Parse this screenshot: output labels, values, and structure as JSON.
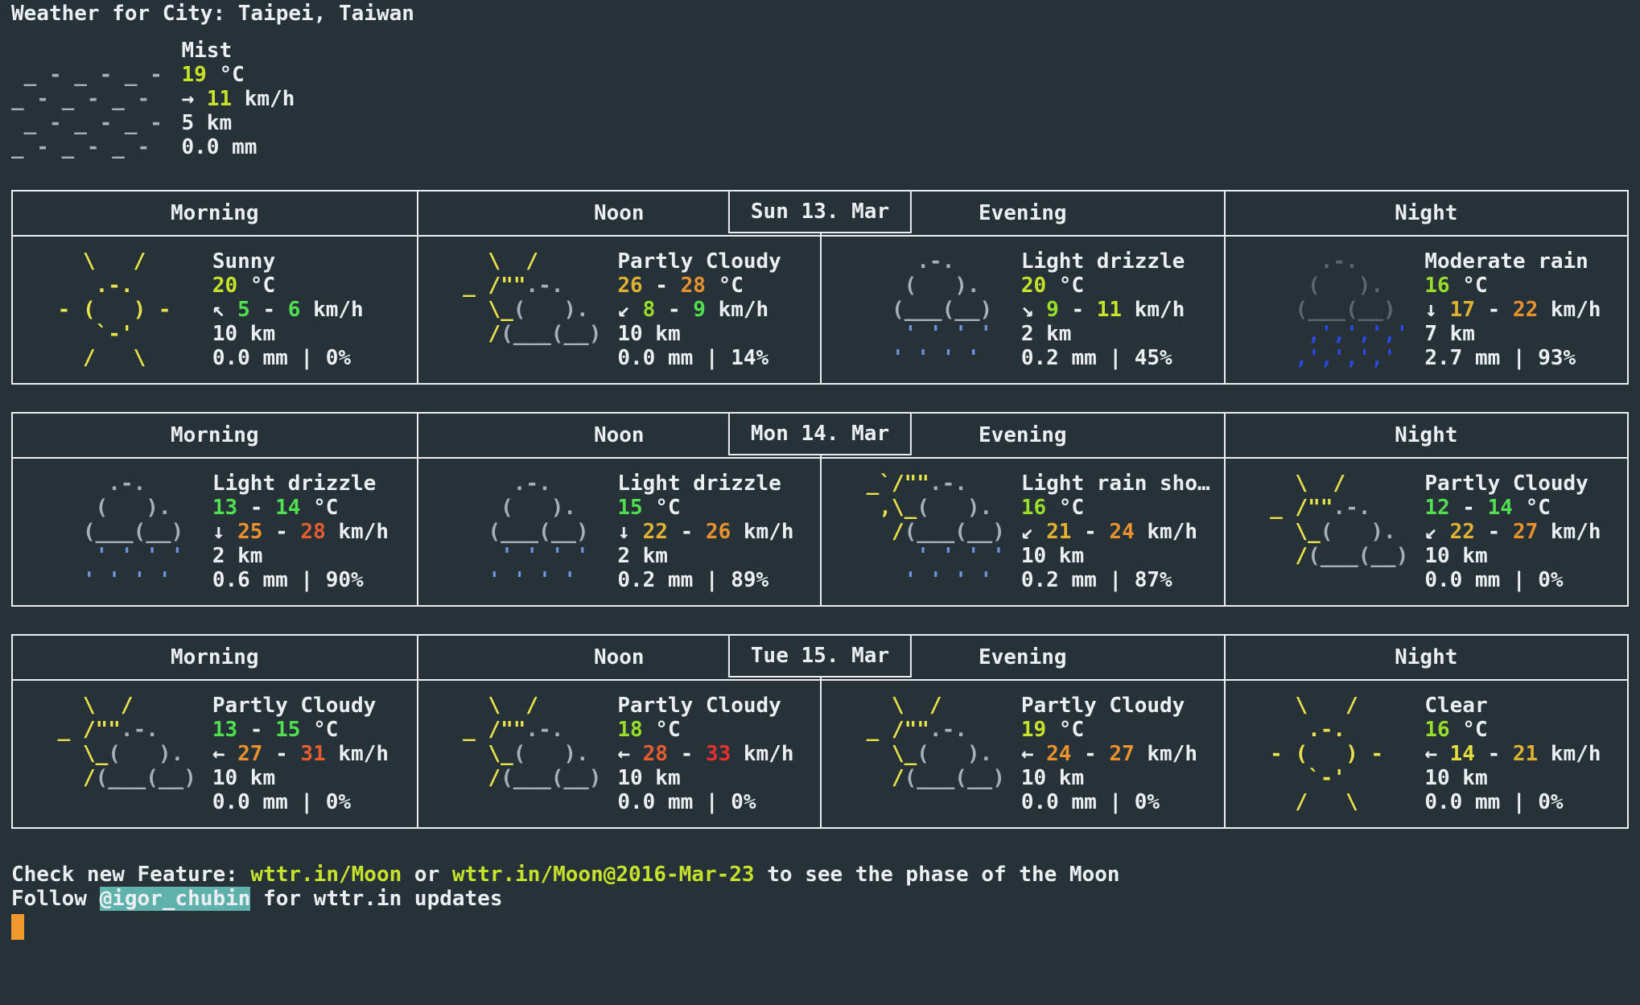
{
  "title": "Weather for City: Taipei, Taiwan",
  "palette": {
    "white": "#eceff1",
    "yellow": "#e9e24b",
    "gray": "#a9b0b5",
    "darkgray": "#5c676d",
    "blue": "#6f93dc",
    "brightblue": "#2a49e8",
    "green": "#50df50",
    "chartreuse": "#97df2b",
    "yellowgreen": "#c6e32a",
    "yellowwind": "#e3dc3e",
    "gold": "#e0b232",
    "orange": "#e8912e",
    "redorange": "#e85c32",
    "red": "#e63030",
    "background": "#263238",
    "border": "#eceff1",
    "link_color": "#c6e32a",
    "highlight_bg": "#5fb2ac",
    "cursor_orange": "#f09a2e"
  },
  "art": {
    "mist": [
      [],
      [
        [
          "gray",
          " _ - _ - _ - "
        ]
      ],
      [
        [
          "gray",
          "_ - _ - _ -  "
        ]
      ],
      [
        [
          "gray",
          " _ - _ - _ - "
        ]
      ],
      [
        [
          "gray",
          "_ - _ - _ -  "
        ]
      ]
    ],
    "sunny": [
      [
        [
          "yellow",
          "   \\   /   "
        ]
      ],
      [
        [
          "yellow",
          "    .-.    "
        ]
      ],
      [
        [
          "yellow",
          " - (   ) - "
        ]
      ],
      [
        [
          "yellow",
          "    `-'    "
        ]
      ],
      [
        [
          "yellow",
          "   /   \\   "
        ]
      ]
    ],
    "partly_cloudy": [
      [
        [
          "yellow",
          "   \\  /"
        ]
      ],
      [
        [
          "yellow",
          " _ /\"\""
        ],
        [
          "gray",
          ".-."
        ]
      ],
      [
        [
          "yellow",
          "   \\_"
        ],
        [
          "gray",
          "(   )."
        ]
      ],
      [
        [
          "yellow",
          "   /"
        ],
        [
          "gray",
          "(___(__)"
        ]
      ],
      []
    ],
    "light_drizzle": [
      [
        [
          "gray",
          "     .-."
        ]
      ],
      [
        [
          "gray",
          "    (   )."
        ]
      ],
      [
        [
          "gray",
          "   (___(__)"
        ]
      ],
      [
        [
          "blue",
          "    ' ' ' '"
        ]
      ],
      [
        [
          "blue",
          "   ' ' ' '"
        ]
      ]
    ],
    "light_rain_shower": [
      [
        [
          "yellow",
          " _`/\"\""
        ],
        [
          "gray",
          ".-."
        ]
      ],
      [
        [
          "yellow",
          "  ,\\_"
        ],
        [
          "gray",
          "(   )."
        ]
      ],
      [
        [
          "yellow",
          "   /"
        ],
        [
          "gray",
          "(___(__)"
        ]
      ],
      [
        [
          "blue",
          "     ' ' ' '"
        ]
      ],
      [
        [
          "blue",
          "    ' ' ' '"
        ]
      ]
    ],
    "moderate_rain": [
      [
        [
          "darkgray",
          "     .-."
        ]
      ],
      [
        [
          "darkgray",
          "    (   )."
        ]
      ],
      [
        [
          "darkgray",
          "   (___(__)"
        ]
      ],
      [
        [
          "brightblue",
          "    ,',',','"
        ]
      ],
      [
        [
          "brightblue",
          "   ,',',','"
        ]
      ]
    ]
  },
  "current": {
    "condition": "Mist",
    "icon": "mist",
    "lines": [
      [
        [
          "white",
          "Mist"
        ]
      ],
      [
        [
          "yellowgreen",
          "19"
        ],
        [
          "white",
          " °C"
        ]
      ],
      [
        [
          "white",
          "→ "
        ],
        [
          "yellowgreen",
          "11"
        ],
        [
          "white",
          " km/h"
        ]
      ],
      [
        [
          "white",
          "5 km"
        ]
      ],
      [
        [
          "white",
          "0.0 mm"
        ]
      ]
    ]
  },
  "days": [
    {
      "label": "Sun 13. Mar",
      "columns": [
        "Morning",
        "Noon",
        "Evening",
        "Night"
      ],
      "cells": [
        {
          "icon": "sunny",
          "lines": [
            [
              [
                "white",
                "Sunny"
              ]
            ],
            [
              [
                "yellowgreen",
                "20"
              ],
              [
                "white",
                " °C"
              ]
            ],
            [
              [
                "white",
                "↖ "
              ],
              [
                "green",
                "5"
              ],
              [
                "white",
                " - "
              ],
              [
                "green",
                "6"
              ],
              [
                "white",
                " km/h"
              ]
            ],
            [
              [
                "white",
                "10 km"
              ]
            ],
            [
              [
                "white",
                "0.0 mm | 0%"
              ]
            ]
          ]
        },
        {
          "icon": "partly_cloudy",
          "lines": [
            [
              [
                "white",
                "Partly Cloudy"
              ]
            ],
            [
              [
                "gold",
                "26"
              ],
              [
                "white",
                " - "
              ],
              [
                "orange",
                "28"
              ],
              [
                "white",
                " °C"
              ]
            ],
            [
              [
                "white",
                "↙ "
              ],
              [
                "chartreuse",
                "8"
              ],
              [
                "white",
                " - "
              ],
              [
                "green",
                "9"
              ],
              [
                "white",
                " km/h"
              ]
            ],
            [
              [
                "white",
                "10 km"
              ]
            ],
            [
              [
                "white",
                "0.0 mm | 14%"
              ]
            ]
          ]
        },
        {
          "icon": "light_drizzle",
          "lines": [
            [
              [
                "white",
                "Light drizzle"
              ]
            ],
            [
              [
                "yellowgreen",
                "20"
              ],
              [
                "white",
                " °C"
              ]
            ],
            [
              [
                "white",
                "↘ "
              ],
              [
                "chartreuse",
                "9"
              ],
              [
                "white",
                " - "
              ],
              [
                "yellowgreen",
                "11"
              ],
              [
                "white",
                " km/h"
              ]
            ],
            [
              [
                "white",
                "2 km"
              ]
            ],
            [
              [
                "white",
                "0.2 mm | 45%"
              ]
            ]
          ]
        },
        {
          "icon": "moderate_rain",
          "lines": [
            [
              [
                "white",
                "Moderate rain"
              ]
            ],
            [
              [
                "chartreuse",
                "16"
              ],
              [
                "white",
                " °C"
              ]
            ],
            [
              [
                "white",
                "↓ "
              ],
              [
                "gold",
                "17"
              ],
              [
                "white",
                " - "
              ],
              [
                "orange",
                "22"
              ],
              [
                "white",
                " km/h"
              ]
            ],
            [
              [
                "white",
                "7 km"
              ]
            ],
            [
              [
                "white",
                "2.7 mm | 93%"
              ]
            ]
          ]
        }
      ]
    },
    {
      "label": "Mon 14. Mar",
      "columns": [
        "Morning",
        "Noon",
        "Evening",
        "Night"
      ],
      "cells": [
        {
          "icon": "light_drizzle",
          "lines": [
            [
              [
                "white",
                "Light drizzle"
              ]
            ],
            [
              [
                "green",
                "13"
              ],
              [
                "white",
                " - "
              ],
              [
                "green",
                "14"
              ],
              [
                "white",
                " °C"
              ]
            ],
            [
              [
                "white",
                "↓ "
              ],
              [
                "orange",
                "25"
              ],
              [
                "white",
                " - "
              ],
              [
                "redorange",
                "28"
              ],
              [
                "white",
                " km/h"
              ]
            ],
            [
              [
                "white",
                "2 km"
              ]
            ],
            [
              [
                "white",
                "0.6 mm | 90%"
              ]
            ]
          ]
        },
        {
          "icon": "light_drizzle",
          "lines": [
            [
              [
                "white",
                "Light drizzle"
              ]
            ],
            [
              [
                "green",
                "15"
              ],
              [
                "white",
                " °C"
              ]
            ],
            [
              [
                "white",
                "↓ "
              ],
              [
                "gold",
                "22"
              ],
              [
                "white",
                " - "
              ],
              [
                "orange",
                "26"
              ],
              [
                "white",
                " km/h"
              ]
            ],
            [
              [
                "white",
                "2 km"
              ]
            ],
            [
              [
                "white",
                "0.2 mm | 89%"
              ]
            ]
          ]
        },
        {
          "icon": "light_rain_shower",
          "lines": [
            [
              [
                "white",
                "Light rain sho…"
              ]
            ],
            [
              [
                "chartreuse",
                "16"
              ],
              [
                "white",
                " °C"
              ]
            ],
            [
              [
                "white",
                "↙ "
              ],
              [
                "gold",
                "21"
              ],
              [
                "white",
                " - "
              ],
              [
                "orange",
                "24"
              ],
              [
                "white",
                " km/h"
              ]
            ],
            [
              [
                "white",
                "10 km"
              ]
            ],
            [
              [
                "white",
                "0.2 mm | 87%"
              ]
            ]
          ]
        },
        {
          "icon": "partly_cloudy",
          "lines": [
            [
              [
                "white",
                "Partly Cloudy"
              ]
            ],
            [
              [
                "green",
                "12"
              ],
              [
                "white",
                " - "
              ],
              [
                "green",
                "14"
              ],
              [
                "white",
                " °C"
              ]
            ],
            [
              [
                "white",
                "↙ "
              ],
              [
                "gold",
                "22"
              ],
              [
                "white",
                " - "
              ],
              [
                "orange",
                "27"
              ],
              [
                "white",
                " km/h"
              ]
            ],
            [
              [
                "white",
                "10 km"
              ]
            ],
            [
              [
                "white",
                "0.0 mm | 0%"
              ]
            ]
          ]
        }
      ]
    },
    {
      "label": "Tue 15. Mar",
      "columns": [
        "Morning",
        "Noon",
        "Evening",
        "Night"
      ],
      "cells": [
        {
          "icon": "partly_cloudy",
          "lines": [
            [
              [
                "white",
                "Partly Cloudy"
              ]
            ],
            [
              [
                "green",
                "13"
              ],
              [
                "white",
                " - "
              ],
              [
                "green",
                "15"
              ],
              [
                "white",
                " °C"
              ]
            ],
            [
              [
                "white",
                "← "
              ],
              [
                "orange",
                "27"
              ],
              [
                "white",
                " - "
              ],
              [
                "redorange",
                "31"
              ],
              [
                "white",
                " km/h"
              ]
            ],
            [
              [
                "white",
                "10 km"
              ]
            ],
            [
              [
                "white",
                "0.0 mm | 0%"
              ]
            ]
          ]
        },
        {
          "icon": "partly_cloudy",
          "lines": [
            [
              [
                "white",
                "Partly Cloudy"
              ]
            ],
            [
              [
                "chartreuse",
                "18"
              ],
              [
                "white",
                " °C"
              ]
            ],
            [
              [
                "white",
                "← "
              ],
              [
                "redorange",
                "28"
              ],
              [
                "white",
                " - "
              ],
              [
                "red",
                "33"
              ],
              [
                "white",
                " km/h"
              ]
            ],
            [
              [
                "white",
                "10 km"
              ]
            ],
            [
              [
                "white",
                "0.0 mm | 0%"
              ]
            ]
          ]
        },
        {
          "icon": "partly_cloudy",
          "lines": [
            [
              [
                "white",
                "Partly Cloudy"
              ]
            ],
            [
              [
                "yellowgreen",
                "19"
              ],
              [
                "white",
                " °C"
              ]
            ],
            [
              [
                "white",
                "← "
              ],
              [
                "orange",
                "24"
              ],
              [
                "white",
                " - "
              ],
              [
                "orange",
                "27"
              ],
              [
                "white",
                " km/h"
              ]
            ],
            [
              [
                "white",
                "10 km"
              ]
            ],
            [
              [
                "white",
                "0.0 mm | 0%"
              ]
            ]
          ]
        },
        {
          "icon": "sunny",
          "lines": [
            [
              [
                "white",
                "Clear"
              ]
            ],
            [
              [
                "chartreuse",
                "16"
              ],
              [
                "white",
                " °C"
              ]
            ],
            [
              [
                "white",
                "← "
              ],
              [
                "yellowwind",
                "14"
              ],
              [
                "white",
                " - "
              ],
              [
                "gold",
                "21"
              ],
              [
                "white",
                " km/h"
              ]
            ],
            [
              [
                "white",
                "10 km"
              ]
            ],
            [
              [
                "white",
                "0.0 mm | 0%"
              ]
            ]
          ]
        }
      ]
    }
  ],
  "footer": {
    "line1": [
      [
        "white",
        "Check new Feature: "
      ],
      [
        "link",
        "wttr.in/Moon"
      ],
      [
        "white",
        " or "
      ],
      [
        "link",
        "wttr.in/Moon@2016-Mar-23"
      ],
      [
        "white",
        " to see the phase of the Moon"
      ]
    ],
    "line2": [
      [
        "white",
        "Follow "
      ],
      [
        "highlight",
        "@igor_chubin"
      ],
      [
        "white",
        " for wttr.in updates"
      ]
    ]
  }
}
